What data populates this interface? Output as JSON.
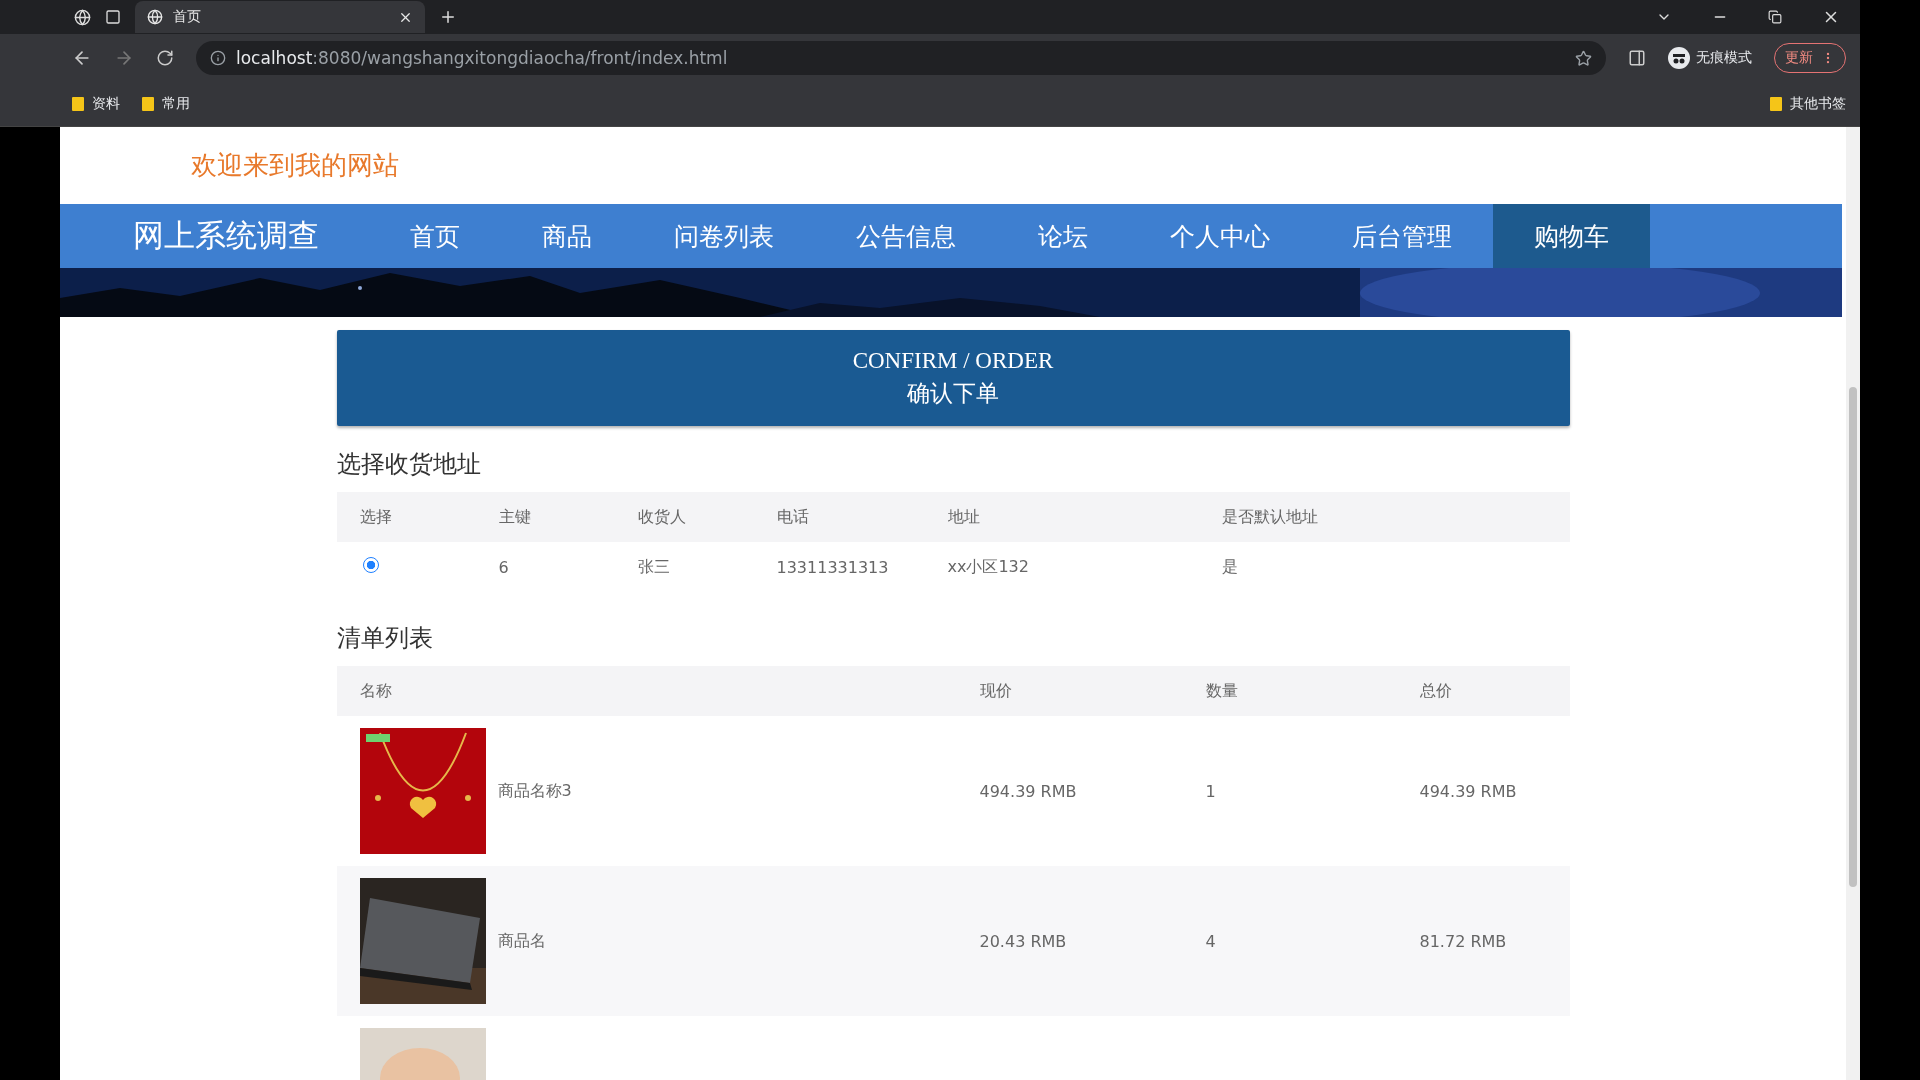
{
  "browser": {
    "tab_title": "首页",
    "url_host": "localhost",
    "url_path": ":8080/wangshangxitongdiaocha/front/index.html",
    "profile_label": "无痕模式",
    "update_button": "更新",
    "bookmarks": [
      "资料",
      "常用"
    ],
    "other_bookmarks": "其他书签"
  },
  "welcome": "欢迎来到我的网站",
  "nav": {
    "brand": "网上系统调查",
    "items": [
      {
        "label": "首页",
        "selected": false
      },
      {
        "label": "商品",
        "selected": false
      },
      {
        "label": "问卷列表",
        "selected": false
      },
      {
        "label": "公告信息",
        "selected": false
      },
      {
        "label": "论坛",
        "selected": false
      },
      {
        "label": "个人中心",
        "selected": false
      },
      {
        "label": "后台管理",
        "selected": false
      },
      {
        "label": "购物车",
        "selected": true
      }
    ]
  },
  "banner": {
    "title_en": "CONFIRM / ORDER",
    "title_zh": "确认下单"
  },
  "address_section": {
    "title": "选择收货地址",
    "columns": [
      "选择",
      "主键",
      "收货人",
      "电话",
      "地址",
      "是否默认地址"
    ],
    "rows": [
      {
        "selected": true,
        "key": "6",
        "consignee": "张三",
        "phone": "13311331313",
        "address": "xx小区132",
        "is_default": "是"
      }
    ]
  },
  "items_section": {
    "title": "清单列表",
    "columns": [
      "名称",
      "现价",
      "数量",
      "总价"
    ],
    "rows": [
      {
        "kind": "picture",
        "name": "商品名称3",
        "price": "494.39 RMB",
        "qty": "1",
        "total": "494.39 RMB"
      },
      {
        "kind": "picture",
        "name": "商品名",
        "price": "20.43 RMB",
        "qty": "4",
        "total": "81.72 RMB"
      },
      {
        "kind": "picture"
      }
    ]
  }
}
